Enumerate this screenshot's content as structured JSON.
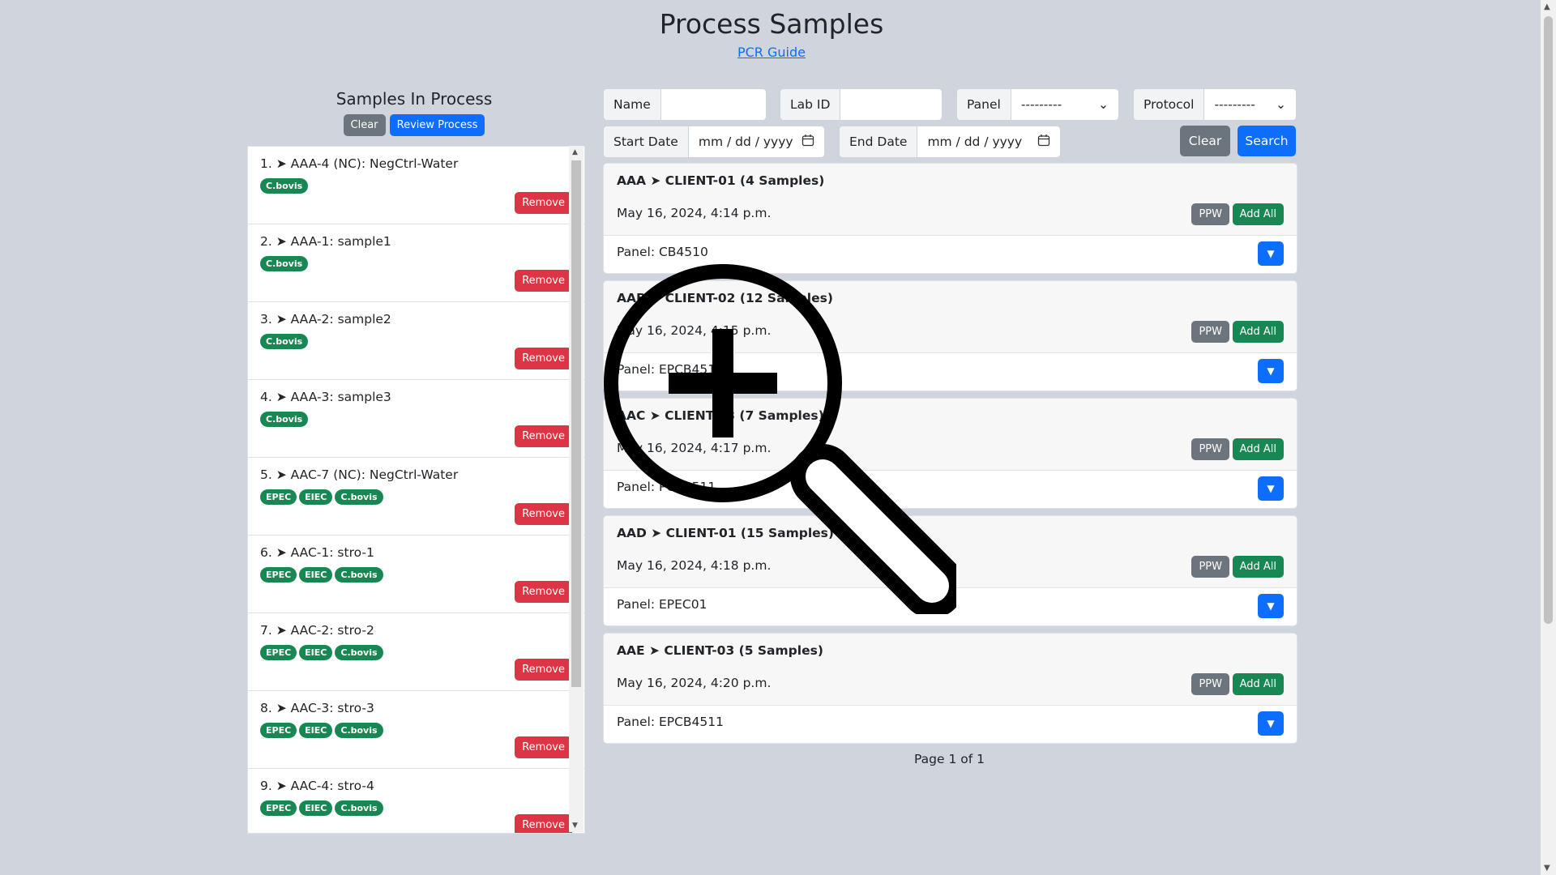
{
  "page": {
    "title": "Process Samples",
    "guide_link": "PCR Guide"
  },
  "left_panel": {
    "title": "Samples In Process",
    "clear_label": "Clear",
    "review_label": "Review Process",
    "remove_label": "Remove",
    "items": [
      {
        "label": "1. ➤ AAA-4 (NC): NegCtrl-Water",
        "tags": [
          "C.bovis"
        ]
      },
      {
        "label": "2. ➤ AAA-1: sample1",
        "tags": [
          "C.bovis"
        ]
      },
      {
        "label": "3. ➤ AAA-2: sample2",
        "tags": [
          "C.bovis"
        ]
      },
      {
        "label": "4. ➤ AAA-3: sample3",
        "tags": [
          "C.bovis"
        ]
      },
      {
        "label": "5. ➤ AAC-7 (NC): NegCtrl-Water",
        "tags": [
          "EPEC",
          "EIEC",
          "C.bovis"
        ]
      },
      {
        "label": "6. ➤ AAC-1: stro-1",
        "tags": [
          "EPEC",
          "EIEC",
          "C.bovis"
        ]
      },
      {
        "label": "7. ➤ AAC-2: stro-2",
        "tags": [
          "EPEC",
          "EIEC",
          "C.bovis"
        ]
      },
      {
        "label": "8. ➤ AAC-3: stro-3",
        "tags": [
          "EPEC",
          "EIEC",
          "C.bovis"
        ]
      },
      {
        "label": "9. ➤ AAC-4: stro-4",
        "tags": [
          "EPEC",
          "EIEC",
          "C.bovis"
        ]
      }
    ]
  },
  "filters": {
    "name_label": "Name",
    "labid_label": "Lab ID",
    "panel_label": "Panel",
    "panel_value": "---------",
    "protocol_label": "Protocol",
    "protocol_value": "---------",
    "start_label": "Start Date",
    "start_value": "mm / dd / yyyy",
    "end_label": "End Date",
    "end_value": "mm / dd / yyyy",
    "clear_label": "Clear",
    "search_label": "Search"
  },
  "cards": [
    {
      "title": "AAA ➤ CLIENT-01 (4 Samples)",
      "date": "May 16, 2024, 4:14 p.m.",
      "panel": "Panel: CB4510"
    },
    {
      "title": "AAB ➤ CLIENT-02 (12 Samples)",
      "date": "May 16, 2024, 4:15 p.m.",
      "panel": "Panel: EPCB4511"
    },
    {
      "title": "AAC ➤ CLIENT-03 (7 Samples)",
      "date": "May 16, 2024, 4:17 p.m.",
      "panel": "Panel: PCB4511"
    },
    {
      "title": "AAD ➤ CLIENT-01 (15 Samples)",
      "date": "May 16, 2024, 4:18 p.m.",
      "panel": "Panel: EPEC01"
    },
    {
      "title": "AAE ➤ CLIENT-03 (5 Samples)",
      "date": "May 16, 2024, 4:20 p.m.",
      "panel": "Panel: EPCB4511"
    }
  ],
  "card_buttons": {
    "ppw": "PPW",
    "add_all": "Add All",
    "expand": "▼"
  },
  "pager": "Page 1 of 1",
  "icons": {
    "zoom_cursor": "zoom-in-magnifier-icon",
    "calendar": "calendar-icon",
    "chevron": "chevron-down-icon"
  },
  "colors": {
    "background": "#d0d4dc",
    "primary": "#0d6efd",
    "success": "#198754",
    "danger": "#dc3545",
    "secondary": "#6c757d"
  }
}
